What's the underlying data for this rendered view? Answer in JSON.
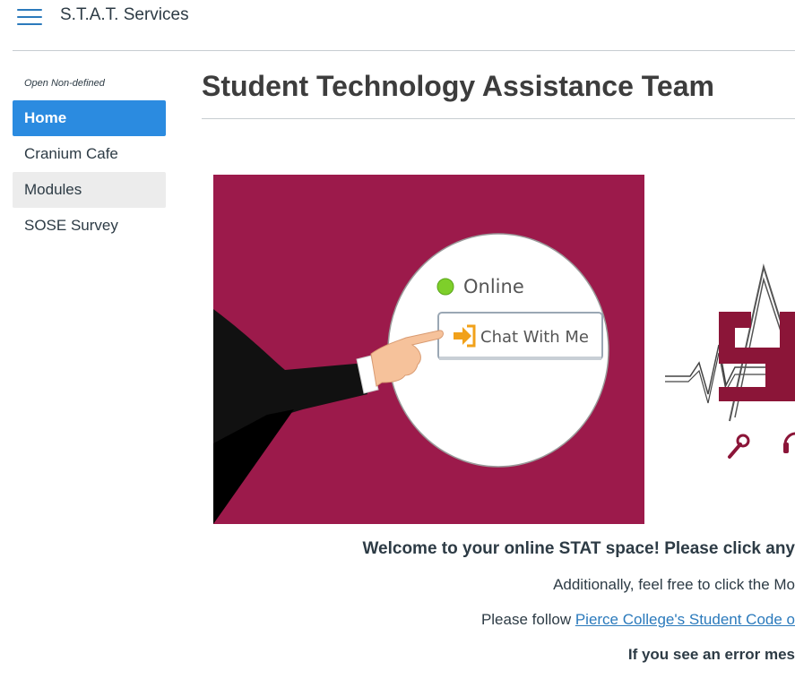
{
  "header": {
    "menu_icon": "hamburger-menu-icon",
    "breadcrumb": "S.T.A.T. Services"
  },
  "sidebar": {
    "term": "Open Non-defined",
    "items": [
      {
        "label": "Home"
      },
      {
        "label": "Cranium Cafe"
      },
      {
        "label": "Modules"
      },
      {
        "label": "SOSE Survey"
      }
    ]
  },
  "main": {
    "title": "Student Technology Assistance Team",
    "banner": {
      "status_text": "Online",
      "button_text": "Chat With Me"
    },
    "welcome": "Welcome to your online STAT space! Please click any",
    "line2": "Additionally, feel free to click the Mo",
    "line3_prefix": "Please follow ",
    "line3_link": "Pierce College's Student Code o",
    "line4": "If you see an error mes"
  },
  "colors": {
    "accent": "#2b8be0",
    "link": "#2b7abc",
    "banner_bg": "#9c1a4b",
    "logo_maroon": "#8b1538"
  }
}
